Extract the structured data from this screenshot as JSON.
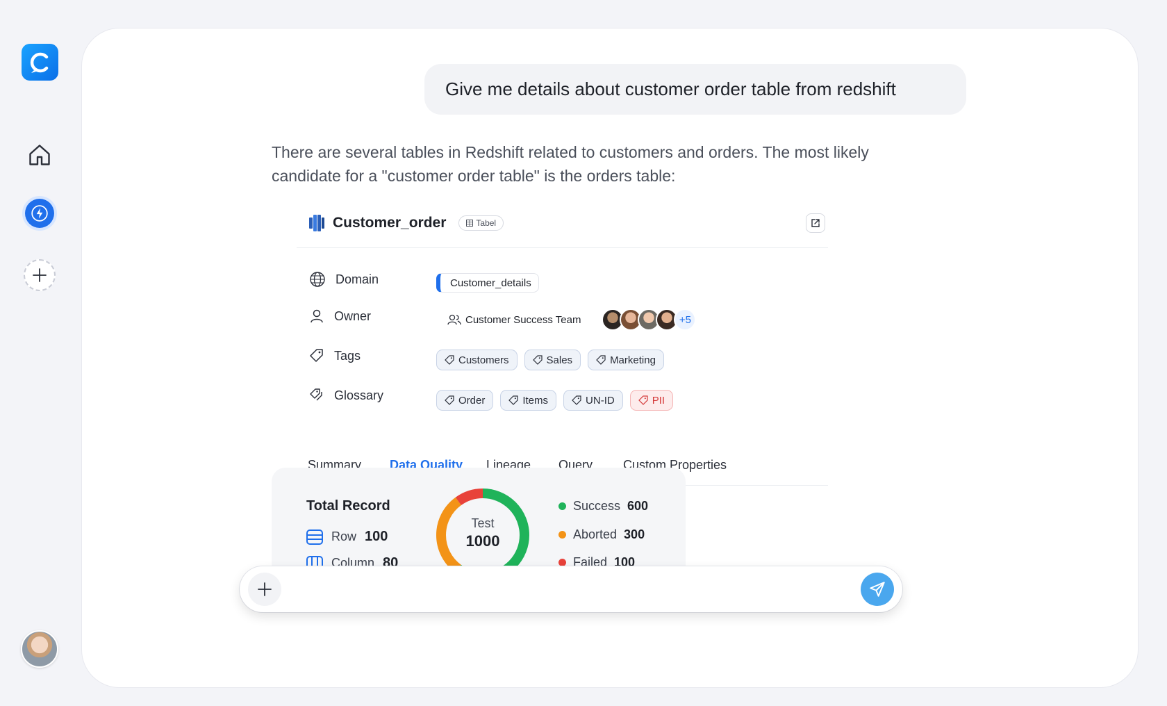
{
  "user_message": "Give me details about customer order table from redshift",
  "answer": "There are several tables in Redshift related to customers and orders. The most likely candidate for a \"customer order table\" is the orders table:",
  "card": {
    "title": "Customer_order",
    "type_label": "Tabel",
    "rows": {
      "domain": {
        "label": "Domain",
        "value": "Customer_details"
      },
      "owner": {
        "label": "Owner",
        "team": "Customer Success Team",
        "more": "+5"
      },
      "tags": {
        "label": "Tags",
        "items": [
          "Customers",
          "Sales",
          "Marketing"
        ]
      },
      "glossary": {
        "label": "Glossary",
        "items": [
          "Order",
          "Items",
          "UN-ID",
          "PII"
        ]
      }
    },
    "tabs": [
      "Summary",
      "Data Quality",
      "Lineage",
      "Query",
      "Custom Properties"
    ],
    "active_tab": "Data Quality"
  },
  "data_quality": {
    "title": "Total Record",
    "row_label": "Row",
    "row_value": "100",
    "column_label": "Column",
    "column_value": "80",
    "donut_label": "Test",
    "donut_value": "1000",
    "legend": [
      {
        "label": "Success",
        "value": "600",
        "color": "#1fb35a"
      },
      {
        "label": "Aborted",
        "value": "300",
        "color": "#f39317"
      },
      {
        "label": "Failed",
        "value": "100",
        "color": "#e8423a"
      }
    ]
  },
  "composer": {
    "placeholder": ""
  },
  "colors": {
    "accent": "#1f6feb",
    "send": "#4aa7ee"
  }
}
